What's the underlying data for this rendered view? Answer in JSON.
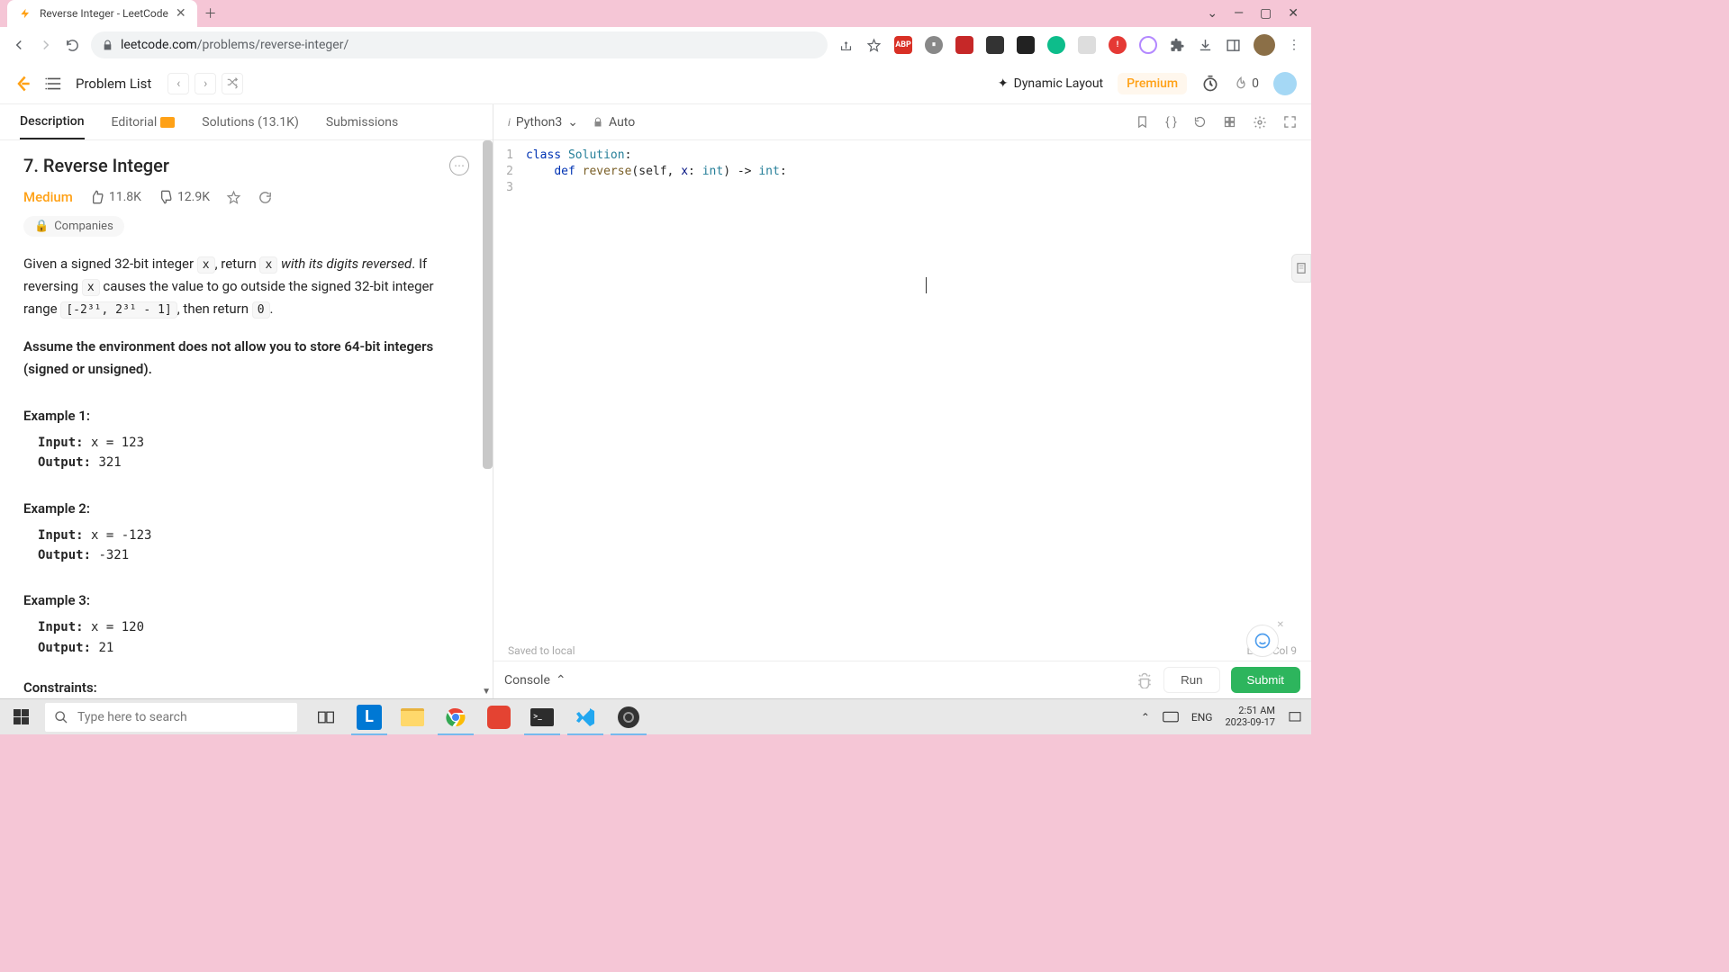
{
  "browser": {
    "tab_title": "Reverse Integer - LeetCode",
    "url_domain": "leetcode.com",
    "url_path": "/problems/reverse-integer/"
  },
  "header": {
    "problem_list": "Problem List",
    "dynamic_layout": "Dynamic Layout",
    "premium": "Premium",
    "streak_count": "0"
  },
  "tabs": {
    "description": "Description",
    "editorial": "Editorial",
    "solutions": "Solutions (13.1K)",
    "submissions": "Submissions"
  },
  "problem": {
    "title": "7. Reverse Integer",
    "difficulty": "Medium",
    "likes": "11.8K",
    "dislikes": "12.9K",
    "companies_label": "Companies",
    "text_a": "Given a signed 32-bit integer ",
    "text_b": ", return ",
    "text_c": " with its digits reversed",
    "text_d": ". If reversing ",
    "text_e": " causes the value to go outside the signed 32-bit integer range ",
    "range_code": "[-2³¹, 2³¹ - 1]",
    "text_f": ", then return ",
    "text_g": ".",
    "code_x": "x",
    "code_zero": "0",
    "assume": "Assume the environment does not allow you to store 64-bit integers (signed or unsigned).",
    "ex1_hdr": "Example 1:",
    "ex1_in_lbl": "Input:",
    "ex1_in_val": " x = 123",
    "ex1_out_lbl": "Output:",
    "ex1_out_val": " 321",
    "ex2_hdr": "Example 2:",
    "ex2_in_lbl": "Input:",
    "ex2_in_val": " x = -123",
    "ex2_out_lbl": "Output:",
    "ex2_out_val": " -321",
    "ex3_hdr": "Example 3:",
    "ex3_in_lbl": "Input:",
    "ex3_in_val": " x = 120",
    "ex3_out_lbl": "Output:",
    "ex3_out_val": " 21",
    "constraints_hdr": "Constraints:"
  },
  "editor": {
    "language": "Python3",
    "auto": "Auto",
    "line1_kw": "class",
    "line1_cls": "Solution",
    "line1_end": ":",
    "line2_def": "def",
    "line2_fn": "reverse",
    "line2_args_a": "(self, ",
    "line2_x": "x",
    "line2_args_b": ": ",
    "line2_int1": "int",
    "line2_args_c": ") -> ",
    "line2_int2": "int",
    "line2_end": ":",
    "ln1": "1",
    "ln2": "2",
    "ln3": "3",
    "saved": "Saved to local",
    "cursor_pos": "Ln 3, Col 9"
  },
  "console": {
    "label": "Console",
    "run": "Run",
    "submit": "Submit"
  },
  "taskbar": {
    "search_placeholder": "Type here to search",
    "lang": "ENG",
    "time": "2:51 AM",
    "date": "2023-09-17"
  }
}
